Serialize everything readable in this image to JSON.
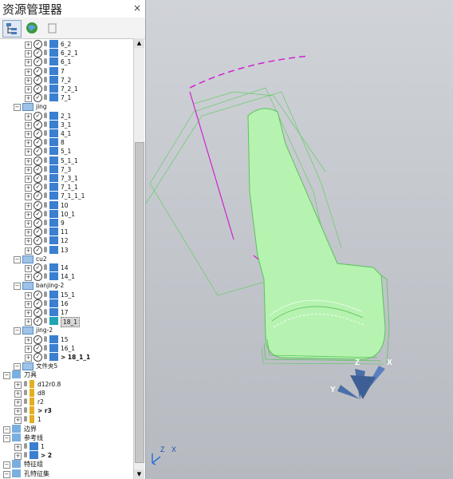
{
  "panel": {
    "title": "资源管理器",
    "close": "×"
  },
  "toolbar": {
    "tree_icon": "tree-view-icon",
    "globe_icon": "globe-icon",
    "trash_icon": "trash-icon"
  },
  "tree": {
    "rows": [
      {
        "label": "6_2",
        "kind": "path"
      },
      {
        "label": "6_2_1",
        "kind": "path"
      },
      {
        "label": "6_1",
        "kind": "path"
      },
      {
        "label": "7",
        "kind": "path"
      },
      {
        "label": "7_2",
        "kind": "path"
      },
      {
        "label": "7_2_1",
        "kind": "path"
      },
      {
        "label": "7_1",
        "kind": "path"
      },
      {
        "label": "jing",
        "kind": "folder"
      },
      {
        "label": "2_1",
        "kind": "path"
      },
      {
        "label": "3_1",
        "kind": "path"
      },
      {
        "label": "4_1",
        "kind": "path"
      },
      {
        "label": "8",
        "kind": "path"
      },
      {
        "label": "5_1",
        "kind": "path"
      },
      {
        "label": "5_1_1",
        "kind": "path"
      },
      {
        "label": "7_3",
        "kind": "path"
      },
      {
        "label": "7_3_1",
        "kind": "path"
      },
      {
        "label": "7_1_1",
        "kind": "path"
      },
      {
        "label": "7_1_1_1",
        "kind": "path"
      },
      {
        "label": "10",
        "kind": "path"
      },
      {
        "label": "10_1",
        "kind": "path"
      },
      {
        "label": "9",
        "kind": "path"
      },
      {
        "label": "11",
        "kind": "path"
      },
      {
        "label": "12",
        "kind": "path"
      },
      {
        "label": "13",
        "kind": "path"
      },
      {
        "label": "cu2",
        "kind": "folder"
      },
      {
        "label": "14",
        "kind": "path"
      },
      {
        "label": "14_1",
        "kind": "path"
      },
      {
        "label": "banjing-2",
        "kind": "folder"
      },
      {
        "label": "15_1",
        "kind": "path"
      },
      {
        "label": "16",
        "kind": "path"
      },
      {
        "label": "17",
        "kind": "path"
      },
      {
        "label": "18_1",
        "kind": "path",
        "selected": true
      },
      {
        "label": "jing-2",
        "kind": "folder"
      },
      {
        "label": "15",
        "kind": "path"
      },
      {
        "label": "16_1",
        "kind": "path"
      },
      {
        "label": "> 18_1_1",
        "kind": "path",
        "bold": true
      },
      {
        "label": "文件夹5",
        "kind": "folder"
      },
      {
        "label": "刀具",
        "kind": "group"
      },
      {
        "label": "d12r0.8",
        "kind": "tool"
      },
      {
        "label": "d8",
        "kind": "tool"
      },
      {
        "label": "r2",
        "kind": "tool"
      },
      {
        "label": "> r3",
        "kind": "tool",
        "bold": true
      },
      {
        "label": "1",
        "kind": "tool"
      },
      {
        "label": "边界",
        "kind": "group"
      },
      {
        "label": "参考线",
        "kind": "group"
      },
      {
        "label": "1",
        "kind": "ref"
      },
      {
        "label": "> 2",
        "kind": "ref",
        "bold": true
      },
      {
        "label": "特征组",
        "kind": "group"
      },
      {
        "label": "孔特征集",
        "kind": "group"
      }
    ]
  },
  "viewport": {
    "axis_labels": {
      "z": "Z",
      "x": "X",
      "y": "Y",
      "small_z": "Z",
      "small_x": "X"
    },
    "colors": {
      "background": "#c3c6cb",
      "part": "#b6f2b0",
      "edge": "#58c45a",
      "magenta": "#d020d0",
      "triad": "#4a6fa8"
    }
  }
}
